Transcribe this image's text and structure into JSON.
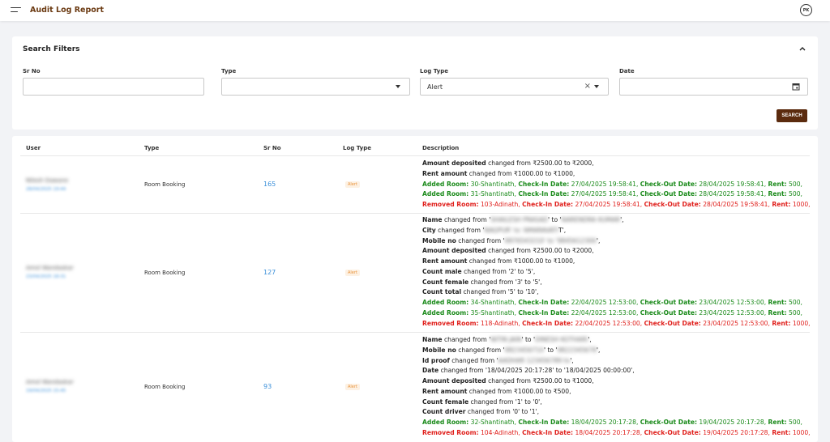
{
  "header": {
    "title": "Audit Log Report",
    "avatar_initials": "PK"
  },
  "filters": {
    "title": "Search Filters",
    "sr_no_label": "Sr No",
    "type_label": "Type",
    "log_type_label": "Log Type",
    "log_type_value": "Alert",
    "date_label": "Date",
    "search_button": "SEARCH"
  },
  "table": {
    "headers": {
      "user": "User",
      "type": "Type",
      "sr_no": "Sr No",
      "log_type": "Log Type",
      "description": "Description"
    },
    "rows": [
      {
        "user_name": "Nilesh Dawane",
        "user_date": "28/04/2025 19:44",
        "type": "Room Booking",
        "sr_no": "165",
        "log_type": "Alert",
        "lines": [
          {
            "bold": "Amount deposited",
            "rest": " changed from ₹2500.00 to ₹2000,"
          },
          {
            "bold": "Rent amount",
            "rest": " changed from ₹1000.00 to ₹1000,"
          },
          {
            "kind": "added",
            "a1": "Added Room:",
            "v1": " 30-Shantinath, ",
            "a2": "Check-In Date:",
            "v2": " 27/04/2025 19:58:41, ",
            "a3": "Check-Out Date:",
            "v3": " 28/04/2025 19:58:41, ",
            "a4": "Rent:",
            "v4": " 500,"
          },
          {
            "kind": "added",
            "a1": "Added Room:",
            "v1": " 31-Shantinath, ",
            "a2": "Check-In Date:",
            "v2": " 27/04/2025 19:58:41, ",
            "a3": "Check-Out Date:",
            "v3": " 28/04/2025 19:58:41, ",
            "a4": "Rent:",
            "v4": " 500,"
          },
          {
            "kind": "removed",
            "a1": "Removed Room:",
            "v1": " 103-Adinath, ",
            "a2": "Check-In Date:",
            "v2": " 27/04/2025 19:58:41, ",
            "a3": "Check-Out Date:",
            "v3": " 28/04/2025 19:58:41, ",
            "a4": "Rent:",
            "v4": " 1000,"
          }
        ]
      },
      {
        "user_name": "Amol Wandaskar",
        "user_date": "23/04/2025 18:31",
        "type": "Room Booking",
        "sr_no": "127",
        "log_type": "Alert",
        "lines": [
          {
            "bold": "Name",
            "rest": " changed from '",
            "blur1": "SHAILESH PRASAD",
            "mid": "' to '",
            "blur2": "NARENDRA KUMAR",
            "end": "',"
          },
          {
            "bold": "City",
            "rest": " changed from '",
            "blur1": "NAGPUR' to 'AMARAVATI",
            "end": "T',"
          },
          {
            "bold": "Mobile no",
            "rest": " changed from '",
            "blur1": "9876543210' to '9845612300",
            "end": "',"
          },
          {
            "bold": "Amount deposited",
            "rest": " changed from ₹2500.00 to ₹2000,"
          },
          {
            "bold": "Rent amount",
            "rest": " changed from ₹1000.00 to ₹1000,"
          },
          {
            "bold": "Count male",
            "rest": " changed from '2' to '5',"
          },
          {
            "bold": "Count female",
            "rest": " changed from '3' to '5',"
          },
          {
            "bold": "Count total",
            "rest": " changed from '5' to '10',"
          },
          {
            "kind": "added",
            "a1": "Added Room:",
            "v1": " 34-Shantinath, ",
            "a2": "Check-In Date:",
            "v2": " 22/04/2025 12:53:00, ",
            "a3": "Check-Out Date:",
            "v3": " 23/04/2025 12:53:00, ",
            "a4": "Rent:",
            "v4": " 500,"
          },
          {
            "kind": "added",
            "a1": "Added Room:",
            "v1": " 35-Shantinath, ",
            "a2": "Check-In Date:",
            "v2": " 22/04/2025 12:53:00, ",
            "a3": "Check-Out Date:",
            "v3": " 23/04/2025 12:53:00, ",
            "a4": "Rent:",
            "v4": " 500,"
          },
          {
            "kind": "removed",
            "a1": "Removed Room:",
            "v1": " 118-Adinath, ",
            "a2": "Check-In Date:",
            "v2": " 22/04/2025 12:53:00, ",
            "a3": "Check-Out Date:",
            "v3": " 23/04/2025 12:53:00, ",
            "a4": "Rent:",
            "v4": " 1000,"
          }
        ]
      },
      {
        "user_name": "Amol Wandaskar",
        "user_date": "19/04/2025 15:45",
        "type": "Room Booking",
        "sr_no": "93",
        "log_type": "Alert",
        "lines": [
          {
            "bold": "Name",
            "rest": " changed from '",
            "blur1": "NITIN JAIN",
            "mid": "' to '",
            "blur2": "DINESH KOTHARI",
            "end": "',"
          },
          {
            "bold": "Mobile no",
            "rest": " changed from '",
            "blur1": "9823456710",
            "mid": "' to '",
            "blur2": "9822345678",
            "end": "',"
          },
          {
            "bold": "Id proof",
            "rest": " changed from '",
            "blur1": "AADHAR 123456789 to",
            "end": "',"
          },
          {
            "bold": "Date",
            "rest": " changed from '18/04/2025 20:17:28' to '18/04/2025 00:00:00',"
          },
          {
            "bold": "Amount deposited",
            "rest": " changed from ₹2500.00 to ₹1000,"
          },
          {
            "bold": "Rent amount",
            "rest": " changed from ₹1000.00 to ₹500,"
          },
          {
            "bold": "Count female",
            "rest": " changed from '1' to '0',"
          },
          {
            "bold": "Count driver",
            "rest": " changed from '0' to '1',"
          },
          {
            "kind": "added",
            "a1": "Added Room:",
            "v1": " 32-Shantinath, ",
            "a2": "Check-In Date:",
            "v2": " 18/04/2025 20:17:28, ",
            "a3": "Check-Out Date:",
            "v3": " 19/04/2025 20:17:28, ",
            "a4": "Rent:",
            "v4": " 500,"
          },
          {
            "kind": "removed",
            "a1": "Removed Room:",
            "v1": " 104-Adinath, ",
            "a2": "Check-In Date:",
            "v2": " 18/04/2025 20:17:28, ",
            "a3": "Check-Out Date:",
            "v3": " 19/04/2025 20:17:28, ",
            "a4": "Rent:",
            "v4": " 1000,"
          }
        ]
      }
    ]
  },
  "colors": {
    "brand": "#5b2b0e",
    "title": "#6b3a12",
    "link": "#3a8fd9",
    "added": "#1a8a1a",
    "removed": "#e0201c",
    "alert_badge": "#e8923a"
  }
}
